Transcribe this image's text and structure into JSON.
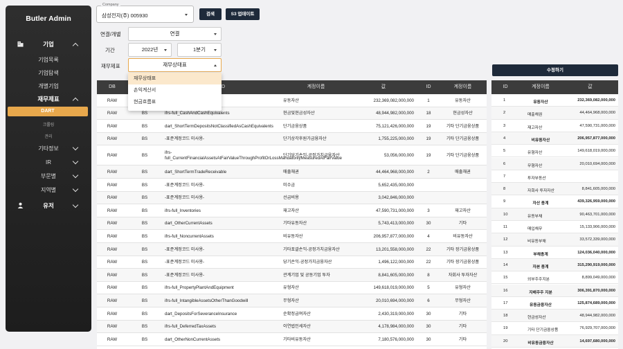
{
  "sidebar": {
    "brand": "Butler Admin",
    "section_company": "기업",
    "company_items": [
      "기업목록",
      "기업탐색",
      "개별기업"
    ],
    "section_finance": "재무제표",
    "active_item": "DART",
    "finance_sub": [
      "크롤링",
      "관리"
    ],
    "other_items": [
      "기타정보",
      "IR",
      "부문별",
      "지역별"
    ],
    "section_user": "유저"
  },
  "filters": {
    "company_legend": "Company",
    "company_value": "삼성전자(주) 005930",
    "search_button": "검색",
    "s3_button": "S3 업데이트",
    "consolidated_label": "연결/개별",
    "consolidated_value": "연결",
    "period_label": "기간",
    "year_value": "2022년",
    "quarter_value": "1분기",
    "statement_label": "재무제표",
    "statement_value": "재무상태표",
    "statement_options": [
      "재무상태표",
      "손익계산서",
      "현금흐름표"
    ],
    "edit_button": "수정하기"
  },
  "main_table": {
    "columns": [
      "DB",
      "FS",
      "ID",
      "계정이름",
      "값",
      "ID",
      "계정이름"
    ],
    "rows": [
      [
        "RAW",
        "BS",
        "ifrs-full_CurrentAssets",
        "유동자산",
        "232,369,082,000,000",
        "1",
        "유동자산"
      ],
      [
        "RAW",
        "BS",
        "ifrs-full_CashAndCashEquivalents",
        "현금및현금성자산",
        "48,944,982,000,000",
        "18",
        "현금성자산"
      ],
      [
        "RAW",
        "BS",
        "dart_ShortTermDepositsNotClassifiedAsCashEquivalents",
        "단기금융상품",
        "75,121,426,000,000",
        "19",
        "기타 단기금융상품"
      ],
      [
        "RAW",
        "BS",
        "-표준계정코드 미사용-",
        "단기상각후원가금융자산",
        "1,755,225,000,000",
        "19",
        "기타 단기금융상품"
      ],
      [
        "RAW",
        "BS",
        "ifrs-full_CurrentFinancialAssetsAtFairValueThroughProfitOrLossMandatorilyMeasuredAtFairValue",
        "단기당기손익-공정가치금융자산",
        "53,056,000,000",
        "19",
        "기타 단기금융상품"
      ],
      [
        "RAW",
        "BS",
        "dart_ShortTermTradeReceivable",
        "매출채권",
        "44,464,968,000,000",
        "2",
        "매출채권"
      ],
      [
        "RAW",
        "BS",
        "-표준계정코드 미사용-",
        "미수금",
        "5,652,435,000,000",
        "",
        ""
      ],
      [
        "RAW",
        "BS",
        "-표준계정코드 미사용-",
        "선급비용",
        "3,042,846,000,000",
        "",
        ""
      ],
      [
        "RAW",
        "BS",
        "ifrs-full_Inventories",
        "재고자산",
        "47,590,731,000,000",
        "3",
        "재고자산"
      ],
      [
        "RAW",
        "BS",
        "dart_OtherCurrentAssets",
        "기타유동자산",
        "5,743,413,000,000",
        "30",
        "기타"
      ],
      [
        "RAW",
        "BS",
        "ifrs-full_NoncurrentAssets",
        "비유동자산",
        "206,957,877,000,000",
        "4",
        "비유동자산"
      ],
      [
        "RAW",
        "BS",
        "-표준계정코드 미사용-",
        "기타포괄손익-공정가치금융자산",
        "13,201,558,000,000",
        "22",
        "기타 장기금융상품"
      ],
      [
        "RAW",
        "BS",
        "-표준계정코드 미사용-",
        "당기손익-공정가치금융자산",
        "1,496,122,000,000",
        "22",
        "기타 장기금융상품"
      ],
      [
        "RAW",
        "BS",
        "-표준계정코드 미사용-",
        "관계기업 및 공동기업 투자",
        "8,841,605,000,000",
        "8",
        "자회사 투자자산"
      ],
      [
        "RAW",
        "BS",
        "ifrs-full_PropertyPlantAndEquipment",
        "유형자산",
        "149,618,019,000,000",
        "5",
        "유형자산"
      ],
      [
        "RAW",
        "BS",
        "ifrs-full_IntangibleAssetsOtherThanGoodwill",
        "무형자산",
        "20,010,694,000,000",
        "6",
        "무형자산"
      ],
      [
        "RAW",
        "BS",
        "dart_DepositsForSeveranceInsurance",
        "순확정급여자산",
        "2,430,319,000,000",
        "30",
        "기타"
      ],
      [
        "RAW",
        "BS",
        "ifrs-full_DeferredTaxAssets",
        "이연법인세자산",
        "4,178,984,000,000",
        "30",
        "기타"
      ],
      [
        "RAW",
        "BS",
        "dart_OtherNonCurrentAssets",
        "기타비유동자산",
        "7,180,576,000,000",
        "30",
        "기타"
      ]
    ]
  },
  "side_table": {
    "columns": [
      "ID",
      "계정이름",
      "값"
    ],
    "rows": [
      [
        "1",
        "유동자산",
        "232,369,082,000,000",
        true
      ],
      [
        "2",
        "매출채권",
        "44,464,968,000,000",
        false
      ],
      [
        "3",
        "재고자산",
        "47,590,731,000,000",
        false
      ],
      [
        "4",
        "비유동자산",
        "206,957,877,000,000",
        true
      ],
      [
        "5",
        "유형자산",
        "149,618,019,000,000",
        false
      ],
      [
        "6",
        "무형자산",
        "20,010,694,000,000",
        false
      ],
      [
        "7",
        "투자부동산",
        "",
        false
      ],
      [
        "8",
        "자회사 투자자산",
        "8,841,605,000,000",
        false
      ],
      [
        "9",
        "자산 총계",
        "439,326,959,000,000",
        true
      ],
      [
        "10",
        "유동부채",
        "90,463,701,000,000",
        false
      ],
      [
        "11",
        "매입채무",
        "15,133,906,000,000",
        false
      ],
      [
        "12",
        "비유동부채",
        "33,572,339,000,000",
        false
      ],
      [
        "13",
        "부채총계",
        "124,036,040,000,000",
        true
      ],
      [
        "14",
        "자본 총계",
        "315,290,919,000,000",
        true
      ],
      [
        "15",
        "외부주주지분",
        "8,899,049,000,000",
        false
      ],
      [
        "16",
        "지배주주 지분",
        "306,391,870,000,000",
        true
      ],
      [
        "17",
        "유동금융자산",
        "125,874,689,000,000",
        true
      ],
      [
        "18",
        "현금성자산",
        "48,944,982,000,000",
        false
      ],
      [
        "19",
        "기타 단기금융상품",
        "76,929,707,000,000",
        false
      ],
      [
        "20",
        "비유동금융자산",
        "14,697,680,000,000",
        true
      ]
    ]
  }
}
